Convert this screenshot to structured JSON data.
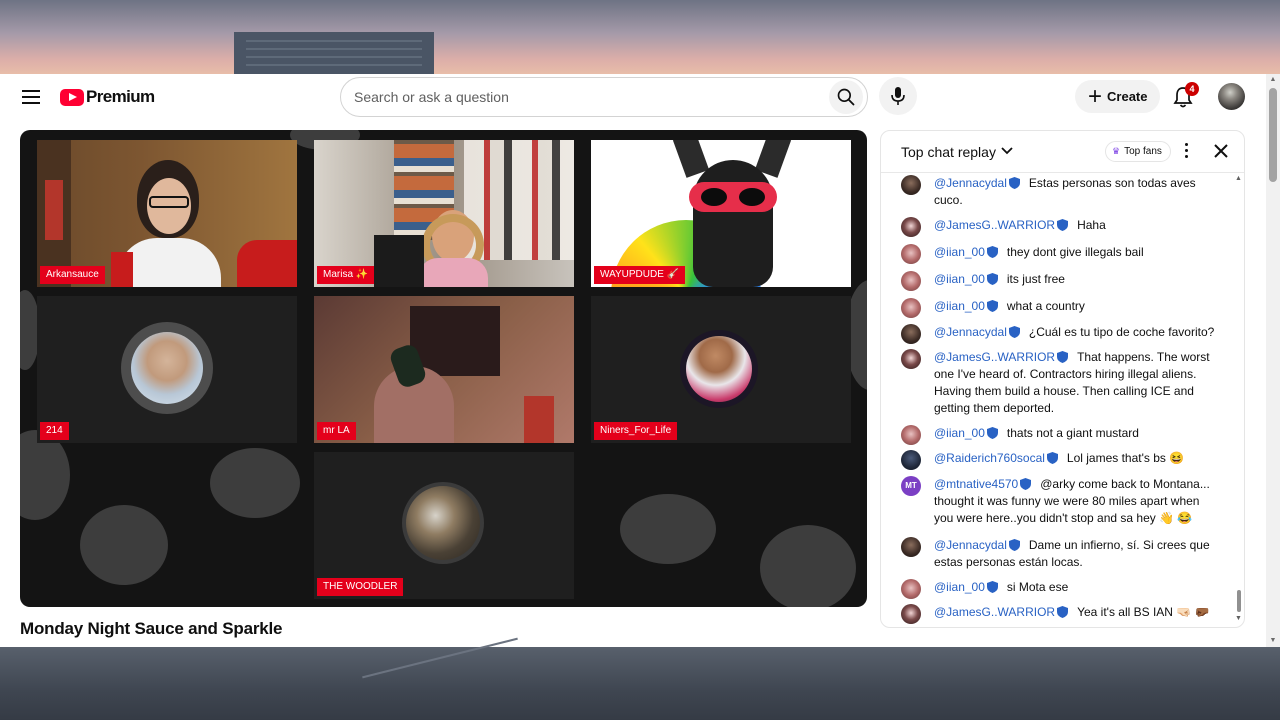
{
  "header": {
    "logo_text": "Premium",
    "search_placeholder": "Search or ask a question",
    "create_label": "Create",
    "notification_count": "4"
  },
  "player": {
    "participants": [
      {
        "name": "Arkansauce"
      },
      {
        "name": "Marisa ✨"
      },
      {
        "name": "WAYUPDUDE 🎸"
      },
      {
        "name": "214"
      },
      {
        "name": "mr LA"
      },
      {
        "name": "Niners_For_Life"
      },
      {
        "name": "THE WOODLER"
      }
    ]
  },
  "video": {
    "title": "Monday Night Sauce and Sparkle"
  },
  "chat": {
    "title": "Top chat replay",
    "top_fans_label": "Top fans",
    "messages": [
      {
        "author": "@Jennacydal",
        "text": "Estas personas son todas aves cuco."
      },
      {
        "author": "@JamesG..WARRIOR",
        "text": "Haha"
      },
      {
        "author": "@iian_00",
        "text": "they dont give illegals bail"
      },
      {
        "author": "@iian_00",
        "text": "its just free"
      },
      {
        "author": "@iian_00",
        "text": "what a country"
      },
      {
        "author": "@Jennacydal",
        "text": "¿Cuál es tu tipo de coche favorito?"
      },
      {
        "author": "@JamesG..WARRIOR",
        "text": "That happens. The worst one I've heard of. Contractors hiring illegal aliens. Having them build a house. Then calling ICE and getting them deported."
      },
      {
        "author": "@iian_00",
        "text": "thats not a giant mustard"
      },
      {
        "author": "@Raiderich760socal",
        "text": "Lol james that's bs 😆"
      },
      {
        "author": "@mtnative4570",
        "avatar_initials": "MT",
        "text": "@arky come back to Montana... thought it was funny we were 80 miles apart when you were here..you didn't stop and sa hey 👋 😂"
      },
      {
        "author": "@Jennacydal",
        "text": "Dame un infierno, sí. Si crees que estas personas están locas."
      },
      {
        "author": "@iian_00",
        "text": "si Mota ese"
      },
      {
        "author": "@JamesG..WARRIOR",
        "text": "Yea it's all BS IAN 🤜🏻 🤛🏾"
      }
    ]
  },
  "colors": {
    "brand_red": "#ff0033",
    "name_tag_red": "#e4001b",
    "author_blue": "#2962c4",
    "top_fans_purple": "#7b3fe4"
  },
  "icons": [
    "menu-icon",
    "youtube-logo-icon",
    "search-icon",
    "microphone-icon",
    "plus-icon",
    "bell-icon",
    "chevron-down-icon",
    "crown-icon",
    "more-vert-icon",
    "close-icon",
    "verified-badge-icon"
  ]
}
